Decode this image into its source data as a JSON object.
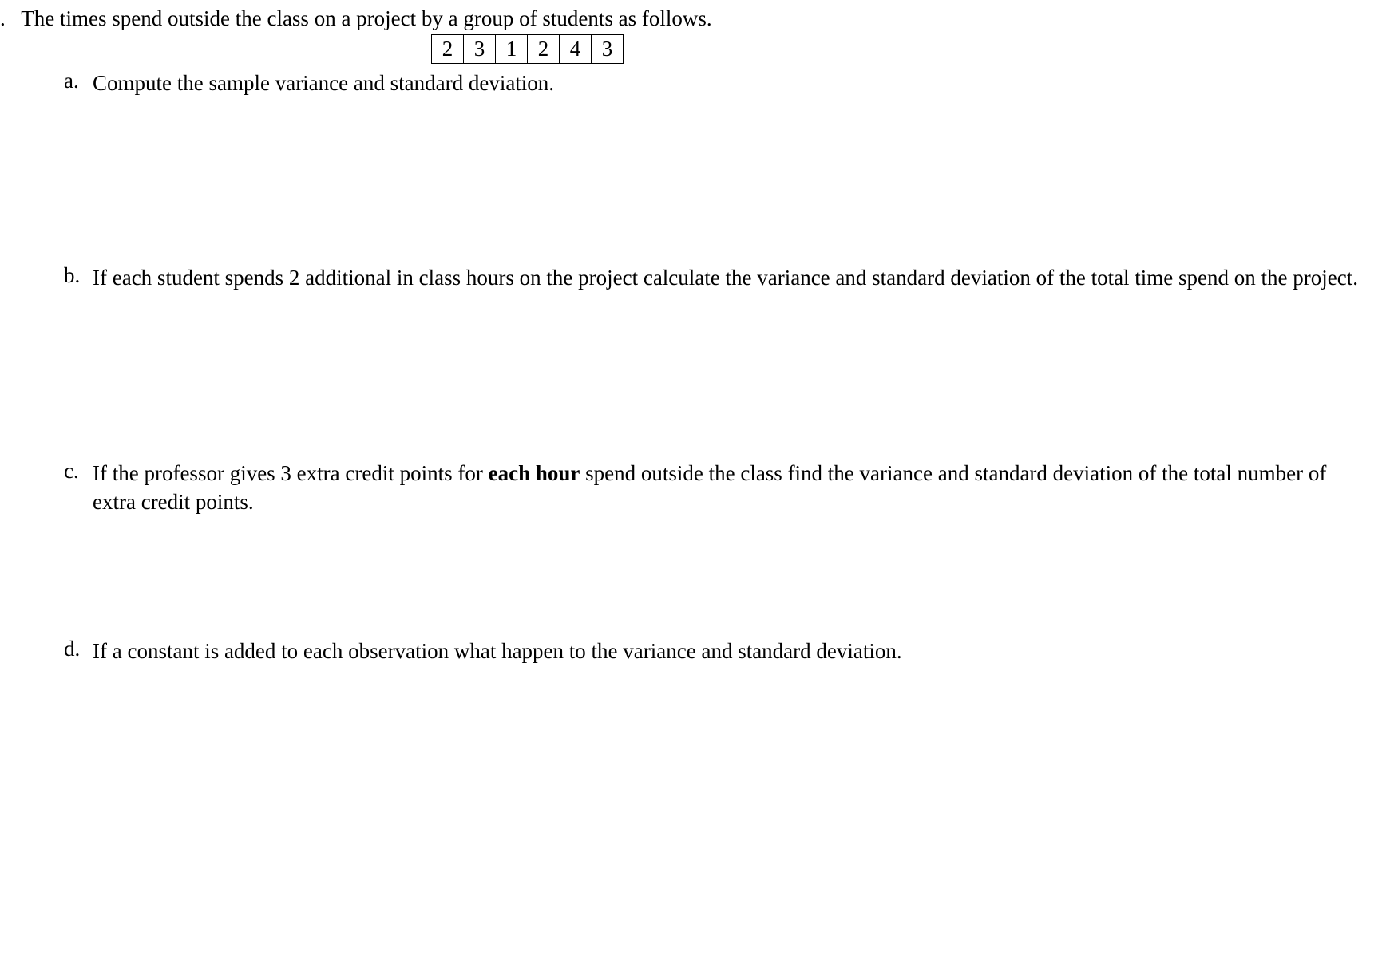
{
  "intro": {
    "leading_period": ".",
    "text": "The times spend outside the class on a project by a group of students as follows."
  },
  "data_values": [
    "2",
    "3",
    "1",
    "2",
    "4",
    "3"
  ],
  "questions": {
    "a": {
      "label": "a.",
      "text": "Compute the sample variance and standard deviation."
    },
    "b": {
      "label": "b.",
      "text": "If each student spends 2 additional in class hours on the project calculate the variance and standard deviation of the total time spend on the project."
    },
    "c": {
      "label": "c.",
      "text_before": "If the professor gives 3 extra credit points for ",
      "bold": "each hour",
      "text_after": " spend outside the class find the variance and standard deviation of the total number of extra credit points."
    },
    "d": {
      "label": "d.",
      "text": "If a constant is added to each observation what happen to the variance and standard deviation."
    }
  }
}
